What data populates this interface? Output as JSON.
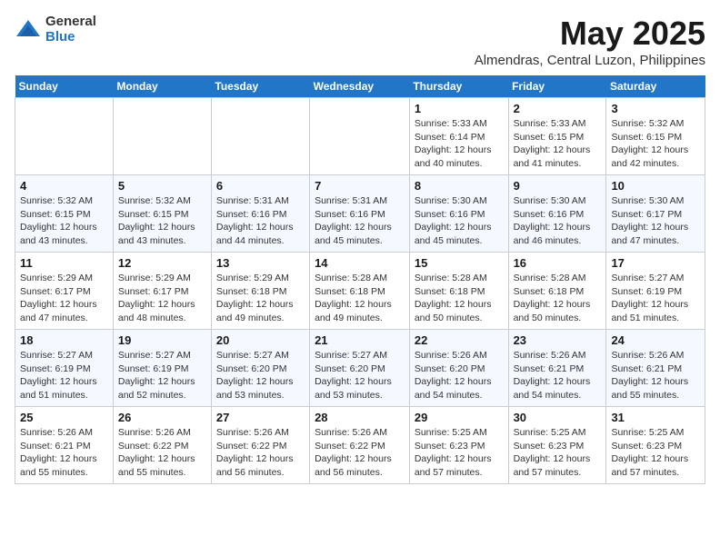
{
  "header": {
    "logo_general": "General",
    "logo_blue": "Blue",
    "month_title": "May 2025",
    "location": "Almendras, Central Luzon, Philippines"
  },
  "days_of_week": [
    "Sunday",
    "Monday",
    "Tuesday",
    "Wednesday",
    "Thursday",
    "Friday",
    "Saturday"
  ],
  "weeks": [
    [
      {
        "day": "",
        "info": ""
      },
      {
        "day": "",
        "info": ""
      },
      {
        "day": "",
        "info": ""
      },
      {
        "day": "",
        "info": ""
      },
      {
        "day": "1",
        "info": "Sunrise: 5:33 AM\nSunset: 6:14 PM\nDaylight: 12 hours\nand 40 minutes."
      },
      {
        "day": "2",
        "info": "Sunrise: 5:33 AM\nSunset: 6:15 PM\nDaylight: 12 hours\nand 41 minutes."
      },
      {
        "day": "3",
        "info": "Sunrise: 5:32 AM\nSunset: 6:15 PM\nDaylight: 12 hours\nand 42 minutes."
      }
    ],
    [
      {
        "day": "4",
        "info": "Sunrise: 5:32 AM\nSunset: 6:15 PM\nDaylight: 12 hours\nand 43 minutes."
      },
      {
        "day": "5",
        "info": "Sunrise: 5:32 AM\nSunset: 6:15 PM\nDaylight: 12 hours\nand 43 minutes."
      },
      {
        "day": "6",
        "info": "Sunrise: 5:31 AM\nSunset: 6:16 PM\nDaylight: 12 hours\nand 44 minutes."
      },
      {
        "day": "7",
        "info": "Sunrise: 5:31 AM\nSunset: 6:16 PM\nDaylight: 12 hours\nand 45 minutes."
      },
      {
        "day": "8",
        "info": "Sunrise: 5:30 AM\nSunset: 6:16 PM\nDaylight: 12 hours\nand 45 minutes."
      },
      {
        "day": "9",
        "info": "Sunrise: 5:30 AM\nSunset: 6:16 PM\nDaylight: 12 hours\nand 46 minutes."
      },
      {
        "day": "10",
        "info": "Sunrise: 5:30 AM\nSunset: 6:17 PM\nDaylight: 12 hours\nand 47 minutes."
      }
    ],
    [
      {
        "day": "11",
        "info": "Sunrise: 5:29 AM\nSunset: 6:17 PM\nDaylight: 12 hours\nand 47 minutes."
      },
      {
        "day": "12",
        "info": "Sunrise: 5:29 AM\nSunset: 6:17 PM\nDaylight: 12 hours\nand 48 minutes."
      },
      {
        "day": "13",
        "info": "Sunrise: 5:29 AM\nSunset: 6:18 PM\nDaylight: 12 hours\nand 49 minutes."
      },
      {
        "day": "14",
        "info": "Sunrise: 5:28 AM\nSunset: 6:18 PM\nDaylight: 12 hours\nand 49 minutes."
      },
      {
        "day": "15",
        "info": "Sunrise: 5:28 AM\nSunset: 6:18 PM\nDaylight: 12 hours\nand 50 minutes."
      },
      {
        "day": "16",
        "info": "Sunrise: 5:28 AM\nSunset: 6:18 PM\nDaylight: 12 hours\nand 50 minutes."
      },
      {
        "day": "17",
        "info": "Sunrise: 5:27 AM\nSunset: 6:19 PM\nDaylight: 12 hours\nand 51 minutes."
      }
    ],
    [
      {
        "day": "18",
        "info": "Sunrise: 5:27 AM\nSunset: 6:19 PM\nDaylight: 12 hours\nand 51 minutes."
      },
      {
        "day": "19",
        "info": "Sunrise: 5:27 AM\nSunset: 6:19 PM\nDaylight: 12 hours\nand 52 minutes."
      },
      {
        "day": "20",
        "info": "Sunrise: 5:27 AM\nSunset: 6:20 PM\nDaylight: 12 hours\nand 53 minutes."
      },
      {
        "day": "21",
        "info": "Sunrise: 5:27 AM\nSunset: 6:20 PM\nDaylight: 12 hours\nand 53 minutes."
      },
      {
        "day": "22",
        "info": "Sunrise: 5:26 AM\nSunset: 6:20 PM\nDaylight: 12 hours\nand 54 minutes."
      },
      {
        "day": "23",
        "info": "Sunrise: 5:26 AM\nSunset: 6:21 PM\nDaylight: 12 hours\nand 54 minutes."
      },
      {
        "day": "24",
        "info": "Sunrise: 5:26 AM\nSunset: 6:21 PM\nDaylight: 12 hours\nand 55 minutes."
      }
    ],
    [
      {
        "day": "25",
        "info": "Sunrise: 5:26 AM\nSunset: 6:21 PM\nDaylight: 12 hours\nand 55 minutes."
      },
      {
        "day": "26",
        "info": "Sunrise: 5:26 AM\nSunset: 6:22 PM\nDaylight: 12 hours\nand 55 minutes."
      },
      {
        "day": "27",
        "info": "Sunrise: 5:26 AM\nSunset: 6:22 PM\nDaylight: 12 hours\nand 56 minutes."
      },
      {
        "day": "28",
        "info": "Sunrise: 5:26 AM\nSunset: 6:22 PM\nDaylight: 12 hours\nand 56 minutes."
      },
      {
        "day": "29",
        "info": "Sunrise: 5:25 AM\nSunset: 6:23 PM\nDaylight: 12 hours\nand 57 minutes."
      },
      {
        "day": "30",
        "info": "Sunrise: 5:25 AM\nSunset: 6:23 PM\nDaylight: 12 hours\nand 57 minutes."
      },
      {
        "day": "31",
        "info": "Sunrise: 5:25 AM\nSunset: 6:23 PM\nDaylight: 12 hours\nand 57 minutes."
      }
    ]
  ]
}
